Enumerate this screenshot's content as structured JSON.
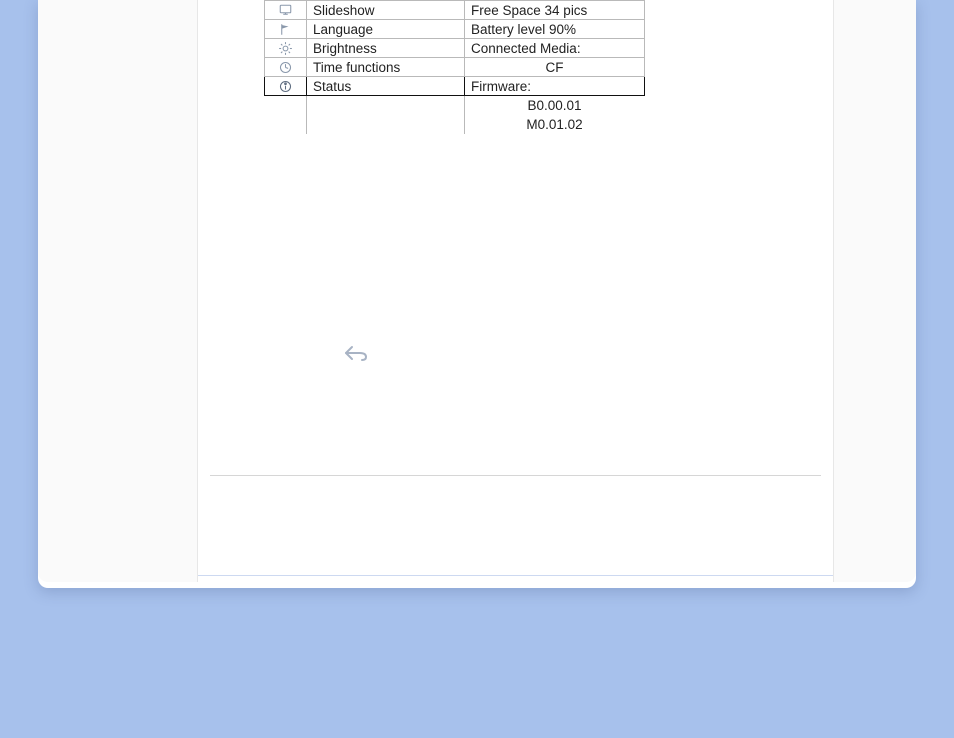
{
  "menu": {
    "items": [
      {
        "icon": "slideshow-icon",
        "label": "Slideshow"
      },
      {
        "icon": "flag-icon",
        "label": "Language"
      },
      {
        "icon": "brightness-icon",
        "label": "Brightness"
      },
      {
        "icon": "clock-icon",
        "label": "Time functions"
      },
      {
        "icon": "info-icon",
        "label": "Status"
      }
    ],
    "selected_index": 4
  },
  "status": {
    "free_space": "Free Space 34 pics",
    "battery_level": "Battery level 90%",
    "connected_media_label": "Connected Media:",
    "connected_media_value": "CF",
    "firmware_label": "Firmware:",
    "firmware_lines": [
      "B0.00.01",
      "M0.01.02"
    ]
  }
}
